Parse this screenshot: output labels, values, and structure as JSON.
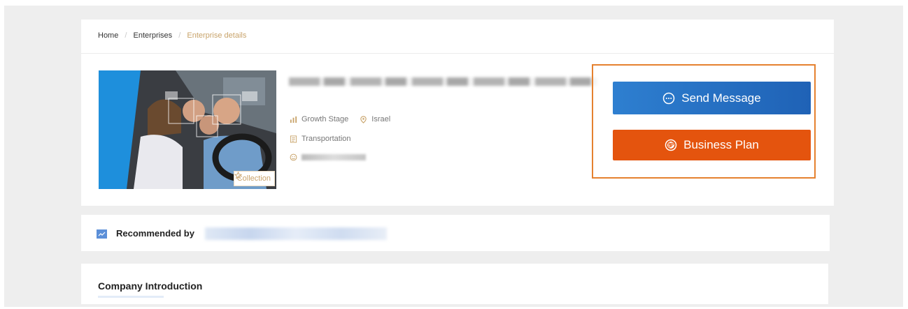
{
  "breadcrumb": {
    "items": [
      "Home",
      "Enterprises"
    ],
    "separator": "/",
    "current": "Enterprise details"
  },
  "profile": {
    "collection_label": "Collection",
    "stage": "Growth Stage",
    "location": "Israel",
    "industry": "Transportation"
  },
  "actions": {
    "send_message_label": "Send Message",
    "business_plan_label": "Business Plan"
  },
  "recommended": {
    "label": "Recommended by"
  },
  "intro": {
    "title": "Company Introduction"
  },
  "colors": {
    "accent_blue": "#2e7fd0",
    "accent_orange": "#e4540e",
    "highlight_border": "#e5812f",
    "gold": "#c8a36a"
  }
}
